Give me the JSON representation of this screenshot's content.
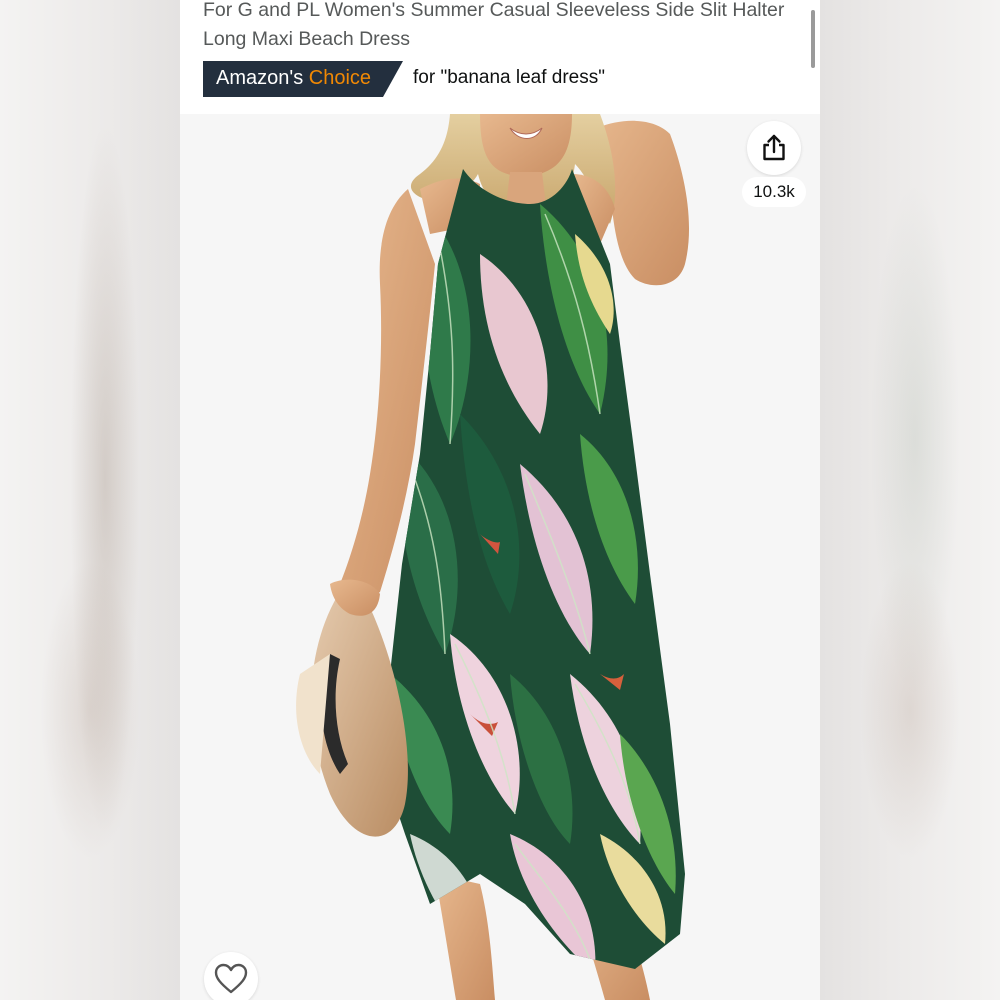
{
  "product": {
    "title": "For G and PL Women's Summer Casual Sleeveless Side Slit Halter Long Maxi Beach Dress"
  },
  "badge": {
    "label_prefix": "Amazon's",
    "label_accent": "Choice",
    "query": "for \"banana leaf dress\"",
    "bg_color": "#232f3e",
    "accent_color": "#f08804"
  },
  "share": {
    "icon": "share-icon",
    "count": "10.3k"
  },
  "favorite": {
    "icon": "heart-icon"
  },
  "image": {
    "alt": "Model wearing green banana leaf print halter maxi dress holding a straw hat"
  }
}
